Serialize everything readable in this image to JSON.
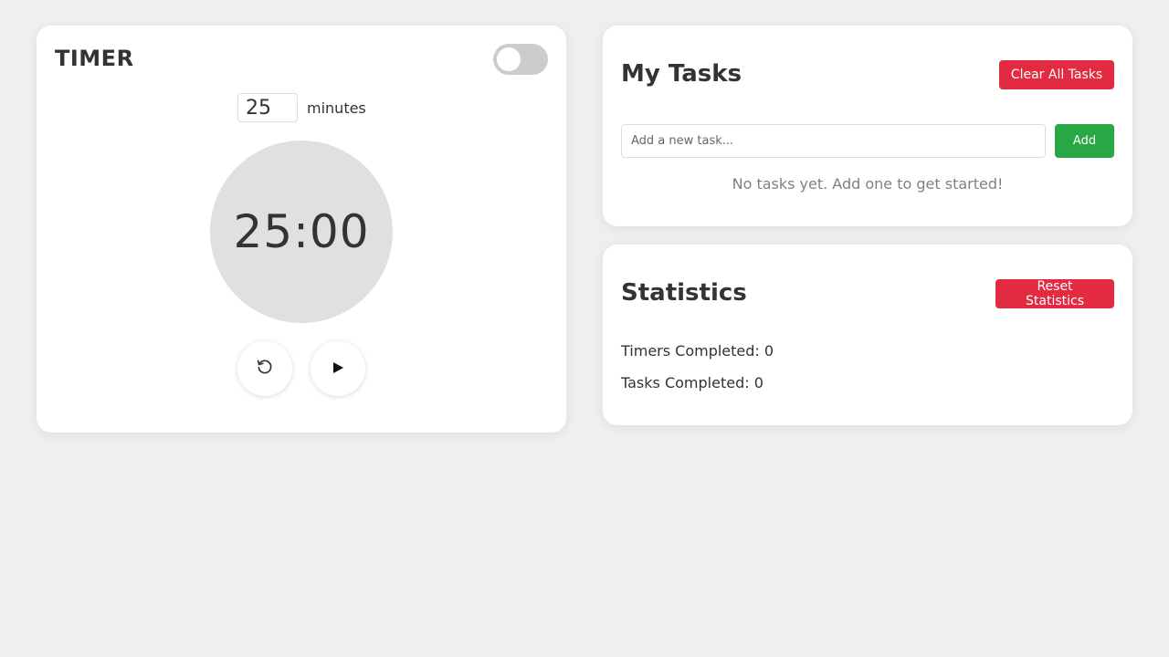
{
  "timer": {
    "title": "TIMER",
    "minutes_value": "25",
    "minutes_label": "minutes",
    "display": "25:00",
    "dark_mode_toggle_on": false,
    "controls": {
      "reset_icon": "reset-icon",
      "play_icon": "play-icon"
    }
  },
  "tasks": {
    "title": "My Tasks",
    "clear_label": "Clear All Tasks",
    "input_placeholder": "Add a new task...",
    "input_value": "",
    "add_label": "Add",
    "empty_message": "No tasks yet. Add one to get started!"
  },
  "statistics": {
    "title": "Statistics",
    "reset_label": "Reset Statistics",
    "timers_completed_label": "Timers Completed: 0",
    "tasks_completed_label": "Tasks Completed: 0"
  },
  "colors": {
    "background": "#efefef",
    "card": "#ffffff",
    "danger": "#e22a40",
    "success": "#28a745",
    "clock_face": "#e0e0e0",
    "toggle_off": "#cccccc"
  }
}
